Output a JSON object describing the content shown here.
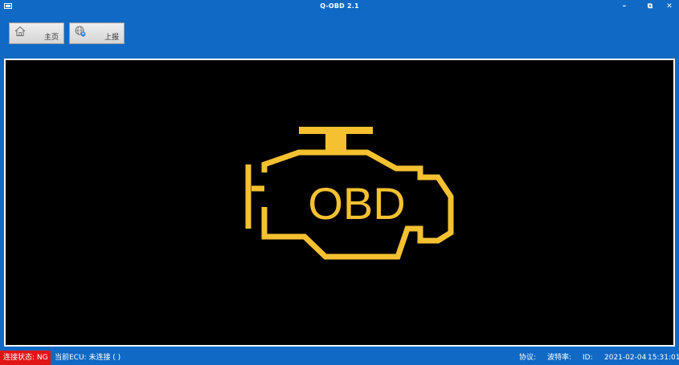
{
  "window": {
    "title": "Q-OBD 2.1",
    "controls": {
      "minimize": "–",
      "restore": "⧉",
      "close": "✕"
    }
  },
  "toolbar": {
    "home_label": "主页",
    "report_label": "上报"
  },
  "display": {
    "logo_text": "OBD",
    "logo_color": "#f5c131"
  },
  "statusbar": {
    "connection_label": "连接状态:",
    "connection_value": "NG",
    "ecu_text": "当前ECU: 未连接 ( )",
    "protocol_label": "协议:",
    "baud_label": "波特率:",
    "id_label": "ID:",
    "date": "2021-02-04",
    "time": "15:31:01"
  },
  "colors": {
    "chrome_blue": "#1069c4",
    "status_error": "#e11515"
  }
}
